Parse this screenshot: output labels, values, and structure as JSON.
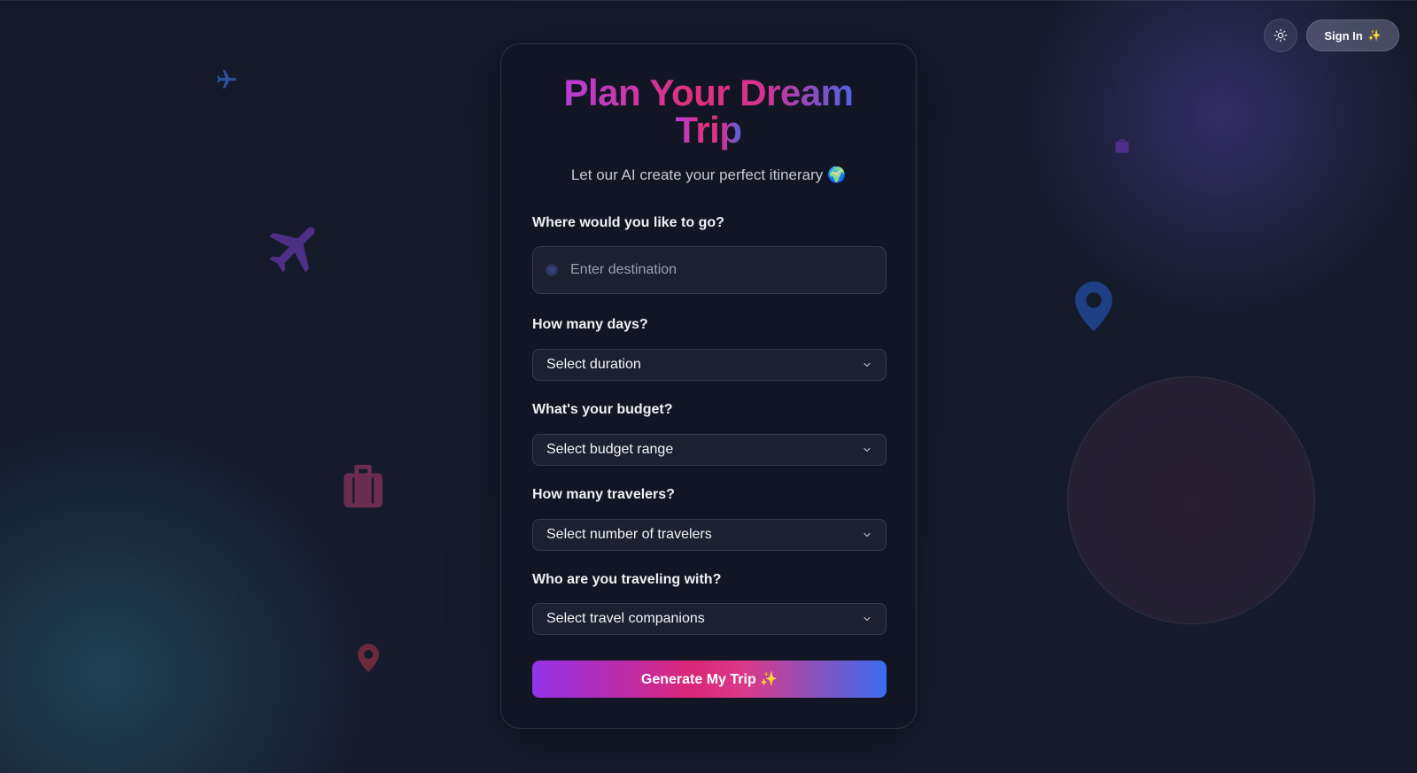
{
  "header": {
    "theme_toggle_icon": "sun-icon",
    "signin_label": "Sign In",
    "signin_emoji": "✨"
  },
  "form": {
    "title_line1": "Plan Your Dream",
    "title_line2": "Trip",
    "subtitle": "Let our AI create your perfect itinerary 🌍",
    "destination": {
      "label": "Where would you like to go?",
      "placeholder": "Enter destination",
      "value": ""
    },
    "days": {
      "label": "How many days?",
      "selected": "Select duration"
    },
    "budget": {
      "label": "What's your budget?",
      "selected": "Select budget range"
    },
    "travelers": {
      "label": "How many travelers?",
      "selected": "Select number of travelers"
    },
    "companions": {
      "label": "Who are you traveling with?",
      "selected": "Select travel companions"
    },
    "submit_label": "Generate My Trip ✨"
  },
  "decorations": {
    "icons": [
      "airplane-icon",
      "airplane-icon",
      "suitcase-icon",
      "suitcase-icon",
      "map-pin-icon",
      "map-pin-icon"
    ],
    "colors": {
      "accent_purple": "#9333ea",
      "accent_pink": "#db2777",
      "accent_blue": "#3b6cf0",
      "background": "#141a29",
      "card": "#121624"
    }
  }
}
